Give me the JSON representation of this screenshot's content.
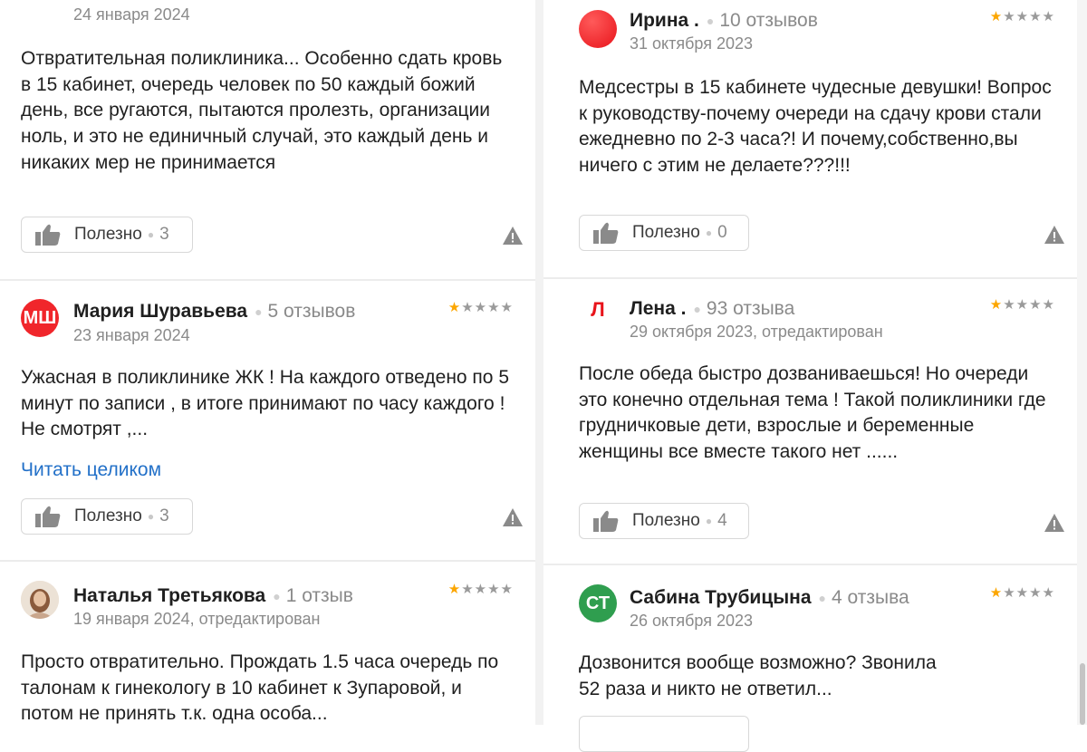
{
  "left": [
    {
      "date": "24 января 2024",
      "text": "Отвратительная поликлиника... Особенно сдать кровь в 15 кабинет, очередь человек по 50 каждый божий день, все ругаются, пытаются пролезть, организации ноль, и это не единичный случай, это каждый день и никаких мер не принимается",
      "useful_label": "Полезно",
      "useful_count": "3"
    },
    {
      "avatar_initials": "МШ",
      "avatar_color": "#f0262b",
      "name": "Мария Шуравьева",
      "reviews": "5 отзывов",
      "date": "23 января 2024",
      "rating": 1,
      "text": "Ужасная в поликлинике ЖК ! На каждого отведено по 5 минут по записи , в итоге принимают по часу каждого ! Не смотрят ,...",
      "read_more": "Читать целиком",
      "useful_label": "Полезно",
      "useful_count": "3"
    },
    {
      "avatar_icon": "user-photo",
      "name": "Наталья Третьякова",
      "reviews": "1 отзыв",
      "date": "19 января 2024, отредактирован",
      "rating": 1,
      "text": "Просто отвратительно. Прождать 1.5 часа очередь по талонам к гинекологу в 10 кабинет к Зупаровой, и потом не принять т.к. одна особа..."
    }
  ],
  "right": [
    {
      "avatar_initials": "",
      "avatar_color": "#f0262b",
      "name": "Ирина .",
      "reviews": "10 отзывов",
      "date": "31 октября 2023",
      "rating": 1,
      "text": "Медсестры в 15 кабинете чудесные девушки! Вопрос к руководству-почему очереди на сдачу крови стали ежедневно по 2-3 часа?! И почему,собственно,вы ничего с этим не делаете???!!!",
      "useful_label": "Полезно",
      "useful_count": "0"
    },
    {
      "avatar_initials": "Л",
      "avatar_color": "#ffffff",
      "avatar_text_color": "#e8141b",
      "name": "Лена .",
      "reviews": "93 отзыва",
      "date": "29 октября 2023, отредактирован",
      "rating": 1,
      "text": "После обеда быстро дозваниваешься! Но очереди это конечно отдельная тема ! Такой поликлиники где грудничковые дети, взрослые и беременные женщины все вместе такого нет ......",
      "useful_label": "Полезно",
      "useful_count": "4"
    },
    {
      "avatar_initials": "СТ",
      "avatar_color": "#2f9e4f",
      "name": "Сабина Трубицына",
      "reviews": "4 отзыва",
      "date": "26 октября 2023",
      "rating": 1,
      "text": "Дозвонится вообще возможно? Звонила 52 раза и никто не ответил..."
    }
  ]
}
